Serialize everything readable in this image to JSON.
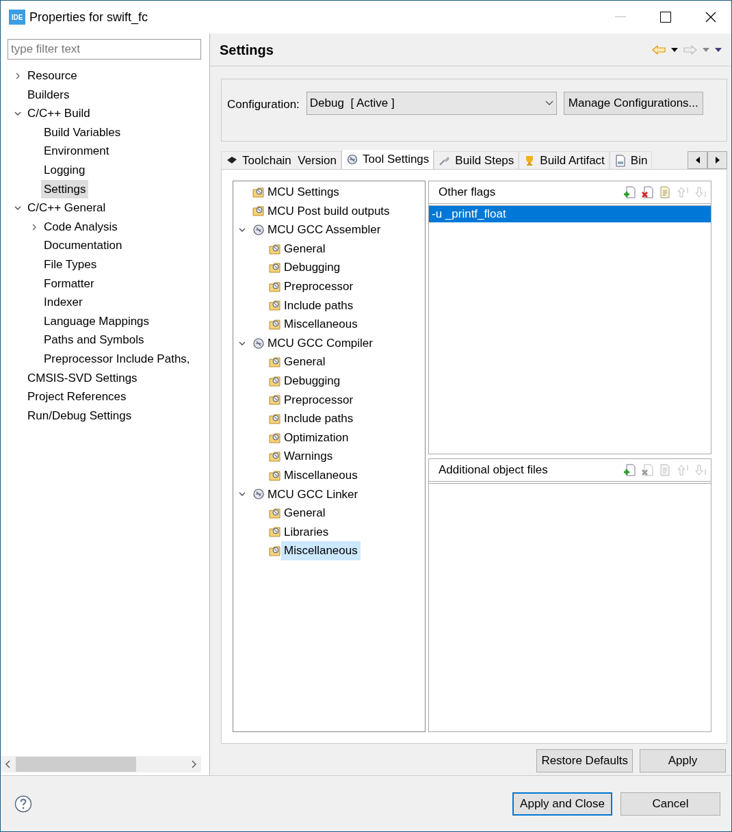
{
  "window": {
    "title": "Properties for swift_fc",
    "app_badge": "IDE"
  },
  "filter": {
    "placeholder": "type filter text"
  },
  "nav_tree": [
    {
      "label": "Resource",
      "expanded": false,
      "selected": false
    },
    {
      "label": "Builders",
      "selected": false
    },
    {
      "label": "C/C++ Build",
      "expanded": true,
      "selected": false,
      "children": [
        {
          "label": "Build Variables",
          "selected": false
        },
        {
          "label": "Environment",
          "selected": false
        },
        {
          "label": "Logging",
          "selected": false
        },
        {
          "label": "Settings",
          "selected": true
        }
      ]
    },
    {
      "label": "C/C++ General",
      "expanded": true,
      "selected": false,
      "children": [
        {
          "label": "Code Analysis",
          "expanded": false,
          "selected": false
        },
        {
          "label": "Documentation",
          "selected": false
        },
        {
          "label": "File Types",
          "selected": false
        },
        {
          "label": "Formatter",
          "selected": false
        },
        {
          "label": "Indexer",
          "selected": false
        },
        {
          "label": "Language Mappings",
          "selected": false
        },
        {
          "label": "Paths and Symbols",
          "selected": false
        },
        {
          "label": "Preprocessor Include Paths,",
          "selected": false
        }
      ]
    },
    {
      "label": "CMSIS-SVD Settings",
      "selected": false
    },
    {
      "label": "Project References",
      "selected": false
    },
    {
      "label": "Run/Debug Settings",
      "selected": false
    }
  ],
  "page_title": "Settings",
  "configuration": {
    "label": "Configuration:",
    "value": "Debug  [ Active ]",
    "button": "Manage Configurations..."
  },
  "tabs": [
    {
      "label": "Toolchain  Version",
      "kind": "chip",
      "selected": false
    },
    {
      "label": "Tool Settings",
      "kind": "gear",
      "selected": true
    },
    {
      "label": "Build Steps",
      "kind": "brush",
      "selected": false
    },
    {
      "label": "Build Artifact",
      "kind": "trophy",
      "selected": false
    },
    {
      "label": "Bin",
      "kind": "binary",
      "selected": false
    }
  ],
  "tool_tree": [
    {
      "label": "MCU Settings",
      "kind": "category",
      "selected": false
    },
    {
      "label": "MCU Post build outputs",
      "kind": "category",
      "selected": false
    },
    {
      "label": "MCU GCC Assembler",
      "kind": "tool",
      "expanded": true,
      "selected": false,
      "children": [
        {
          "label": "General",
          "kind": "category",
          "selected": false
        },
        {
          "label": "Debugging",
          "kind": "category",
          "selected": false
        },
        {
          "label": "Preprocessor",
          "kind": "category",
          "selected": false
        },
        {
          "label": "Include paths",
          "kind": "category",
          "selected": false
        },
        {
          "label": "Miscellaneous",
          "kind": "category",
          "selected": false
        }
      ]
    },
    {
      "label": "MCU GCC Compiler",
      "kind": "tool",
      "expanded": true,
      "selected": false,
      "children": [
        {
          "label": "General",
          "kind": "category",
          "selected": false
        },
        {
          "label": "Debugging",
          "kind": "category",
          "selected": false
        },
        {
          "label": "Preprocessor",
          "kind": "category",
          "selected": false
        },
        {
          "label": "Include paths",
          "kind": "category",
          "selected": false
        },
        {
          "label": "Optimization",
          "kind": "category",
          "selected": false
        },
        {
          "label": "Warnings",
          "kind": "category",
          "selected": false
        },
        {
          "label": "Miscellaneous",
          "kind": "category",
          "selected": false
        }
      ]
    },
    {
      "label": "MCU GCC Linker",
      "kind": "tool",
      "expanded": true,
      "selected": false,
      "children": [
        {
          "label": "General",
          "kind": "category",
          "selected": false
        },
        {
          "label": "Libraries",
          "kind": "category",
          "selected": false
        },
        {
          "label": "Miscellaneous",
          "kind": "category",
          "selected": true
        }
      ]
    }
  ],
  "lists": [
    {
      "title": "Other flags",
      "tools": [
        {
          "kind": "add",
          "disabled": false
        },
        {
          "kind": "delete",
          "disabled": false
        },
        {
          "kind": "edit",
          "disabled": false
        },
        {
          "kind": "up",
          "disabled": true
        },
        {
          "kind": "down",
          "disabled": true
        }
      ],
      "items": [
        {
          "label": "-u _printf_float",
          "selected": true
        }
      ]
    },
    {
      "title": "Additional object files",
      "tools": [
        {
          "kind": "add",
          "disabled": false
        },
        {
          "kind": "delete",
          "disabled": true
        },
        {
          "kind": "edit",
          "disabled": true
        },
        {
          "kind": "up",
          "disabled": true
        },
        {
          "kind": "down",
          "disabled": true
        }
      ]
    }
  ],
  "buttons": [
    "Restore Defaults",
    "Apply"
  ],
  "dialog_buttons": [
    {
      "label": "Apply and Close",
      "default": true
    },
    {
      "label": "Cancel",
      "default": false
    }
  ]
}
